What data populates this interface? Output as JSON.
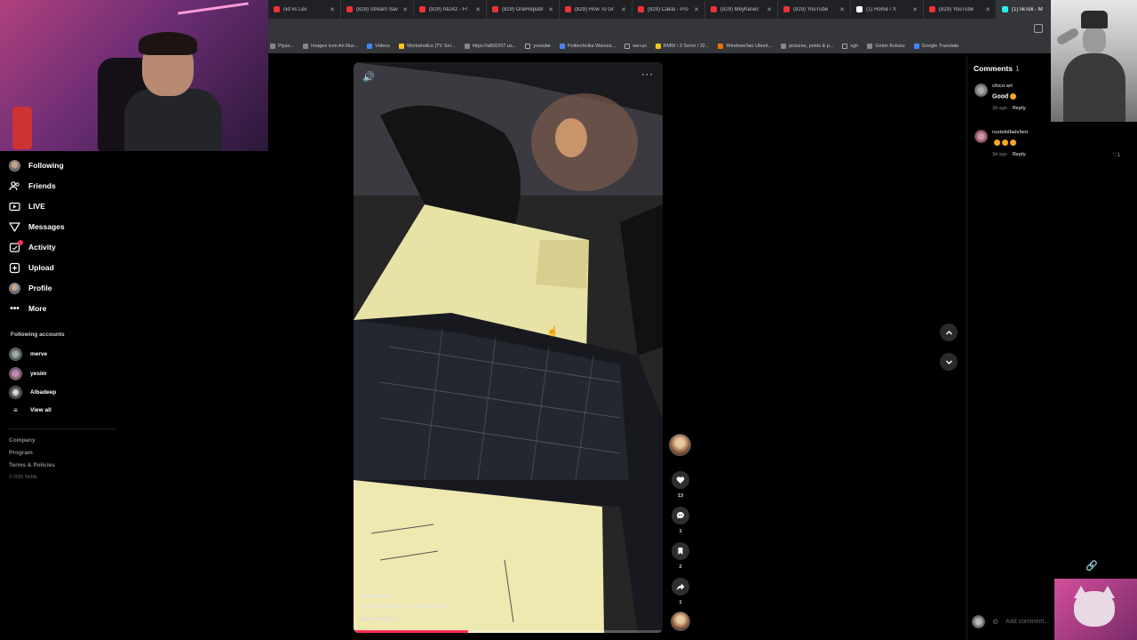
{
  "browser": {
    "tabs": [
      {
        "title": "cid vs Lev",
        "icon": "youtube-icon"
      },
      {
        "title": "(829) Stream Sav",
        "icon": "youtube-icon"
      },
      {
        "title": "(829) Ati242 - Fr",
        "icon": "youtube-icon"
      },
      {
        "title": "(829) OneRepubl",
        "icon": "youtube-icon"
      },
      {
        "title": "(829) How To Gr",
        "icon": "youtube-icon"
      },
      {
        "title": "(829) Cakal - Pro",
        "icon": "youtube-icon"
      },
      {
        "title": "(829) Meyhanec",
        "icon": "youtube-icon"
      },
      {
        "title": "(829) YouTube",
        "icon": "youtube-icon"
      },
      {
        "title": "(1) Home / X",
        "icon": "x-icon"
      },
      {
        "title": "(829) YouTube",
        "icon": "youtube-icon"
      },
      {
        "title": "(1)TikTok - M",
        "icon": "tiktok-icon",
        "active": true
      }
    ],
    "bookmarks": [
      {
        "label": "Piyas...",
        "icon": "page"
      },
      {
        "label": "Images icon Ari illus...",
        "icon": "page"
      },
      {
        "label": "Videos",
        "icon": "globe"
      },
      {
        "label": "Workaholics (TV Ser...",
        "icon": "yellow"
      },
      {
        "label": "https://a800207.us...",
        "icon": "page"
      },
      {
        "label": "youtube",
        "icon": "folder"
      },
      {
        "label": "Politechnika Warsza...",
        "icon": "blue"
      },
      {
        "label": "secuzi",
        "icon": "folder"
      },
      {
        "label": "BMW / 3 Serisi / 32...",
        "icon": "yellow"
      },
      {
        "label": "Windows'tan Ubunt...",
        "icon": "orange"
      },
      {
        "label": "pictures, prints & p...",
        "icon": "page"
      },
      {
        "label": "sgh",
        "icon": "folder"
      },
      {
        "label": "Gelen Kutusu",
        "icon": "page"
      },
      {
        "label": "Google Translate",
        "icon": "blue"
      }
    ]
  },
  "sidebar": {
    "nav": [
      {
        "label": "Following",
        "icon": "avatar"
      },
      {
        "label": "Friends",
        "icon": "friends-icon"
      },
      {
        "label": "LIVE",
        "icon": "live-icon"
      },
      {
        "label": "Messages",
        "icon": "messages-icon"
      },
      {
        "label": "Activity",
        "icon": "activity-icon"
      },
      {
        "label": "Upload",
        "icon": "upload-icon"
      },
      {
        "label": "Profile",
        "icon": "avatar"
      },
      {
        "label": "More",
        "icon": "more-icon"
      }
    ],
    "following_title": "Following accounts",
    "accounts": [
      {
        "name": "merve"
      },
      {
        "name": "yesim"
      },
      {
        "name": "Albadeep"
      }
    ],
    "view_all": "View all",
    "footer": [
      "Company",
      "Program",
      "Terms & Policies"
    ],
    "copyright": "© 2026 TikTok"
  },
  "video": {
    "author": "bdmastuwon",
    "caption": "bu sefer de kapiere yapamadim #tattoo",
    "see_translation": "See translation",
    "progress": 0.37
  },
  "actions": {
    "likes": "13",
    "comments": "1",
    "saves": "2",
    "shares": "1"
  },
  "comments_panel": {
    "title": "Comments",
    "count": "1",
    "items": [
      {
        "user": "chico art",
        "text": "Good",
        "time": "3d ago",
        "reply": "Reply",
        "likes": ""
      },
      {
        "user": "rustekilbalshen",
        "text": "",
        "time": "3d ago",
        "reply": "Reply",
        "likes": "1"
      }
    ],
    "add_placeholder": "Add comment..."
  },
  "colors": {
    "accent": "#fe2c55",
    "background": "#000000"
  }
}
